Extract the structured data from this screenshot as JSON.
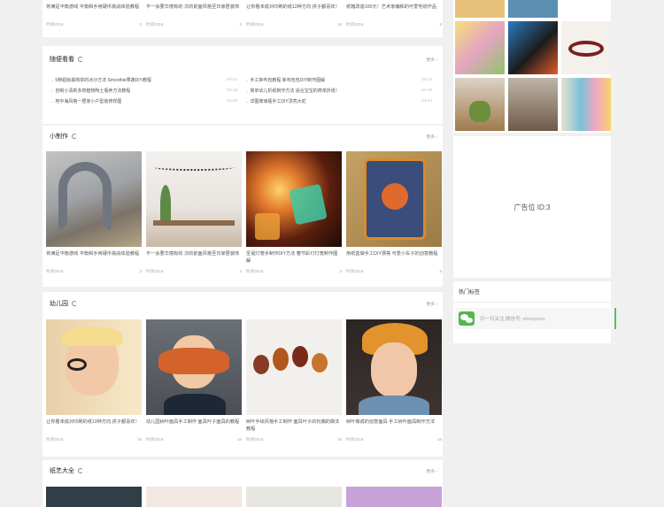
{
  "top_cards": [
    {
      "title": "将满足平衡游戏 平衡和手用硬币挑战体验教程",
      "date": "时间2016",
      "likes": "2"
    },
    {
      "title": "不一会要华丽有的 次的前面风格至日家居装饰",
      "date": "时间2016",
      "likes": "5"
    },
    {
      "title": "让你看未成对印刷的纸12种方向 孩子都喜欢！",
      "date": "时间2016",
      "likes": "16"
    },
    {
      "title": "纸箱改造100元！艺术家编和的可爱宅纸作品",
      "date": "时间2016",
      "likes": "6"
    }
  ],
  "random": {
    "title": "随便看看",
    "more": "更多",
    "items": [
      {
        "text": "5种超级最简单的冰沙方法 Smoothie果蔬DIY教程",
        "date": "04-22"
      },
      {
        "text": "手工钟布包教程 新布包包DIY制作图解",
        "date": "04-12"
      },
      {
        "text": "自制小清新多肉植物陶土瓶养方法教程",
        "date": "04-18"
      },
      {
        "text": "简单幼儿折纸制作方法 适合宝宝的简单折纸！",
        "date": "04-15"
      },
      {
        "text": "地中海风格一居家小户型装修样图",
        "date": "04-08"
      },
      {
        "text": "详图玻璃瓶手工DIY漂亮大蛇",
        "date": "04-04"
      }
    ]
  },
  "xiaozhizuo": {
    "title": "小制作",
    "more": "更多",
    "cards": [
      {
        "title": "将满足平衡游戏 平衡和手用硬币挑战体验教程",
        "date": "时间2016",
        "likes": "3"
      },
      {
        "title": "不一会要华丽有的 次的前面风格至日家居装饰",
        "date": "时间2016",
        "likes": "4"
      },
      {
        "title": "圣诞灯笼手制作DIY方法 春节彩灯灯笼制作图解",
        "date": "时间2016",
        "likes": "4"
      },
      {
        "title": "用纸盒做手工DIY漂亮 可爱小车子的创意教程",
        "date": "时间2016",
        "likes": "6"
      }
    ]
  },
  "youeryuan": {
    "title": "幼儿园",
    "more": "更多",
    "cards": [
      {
        "title": "让你看未成对印刷的纸12种方向 孩子都喜欢！",
        "date": "时间2016",
        "likes": "16"
      },
      {
        "title": "幼儿园树叶面具手工制作 面具叶子面具的教程",
        "date": "时间2016",
        "likes": "18"
      },
      {
        "title": "树叶手绘风格手工制作 面具叶子的玩偶的做法教程",
        "date": "时间2016",
        "likes": "16"
      },
      {
        "title": "树叶做成的创意面具 手工树叶面具制作方法",
        "date": "时间2016",
        "likes": "18"
      }
    ]
  },
  "zheyi": {
    "title": "纸艺大全",
    "more": "更多"
  },
  "sidebar": {
    "ad_label": "广告位 ID:3",
    "hot_title": "热门标签",
    "wechat_text": "扫一扫关注,微信号: shouyinuo"
  }
}
